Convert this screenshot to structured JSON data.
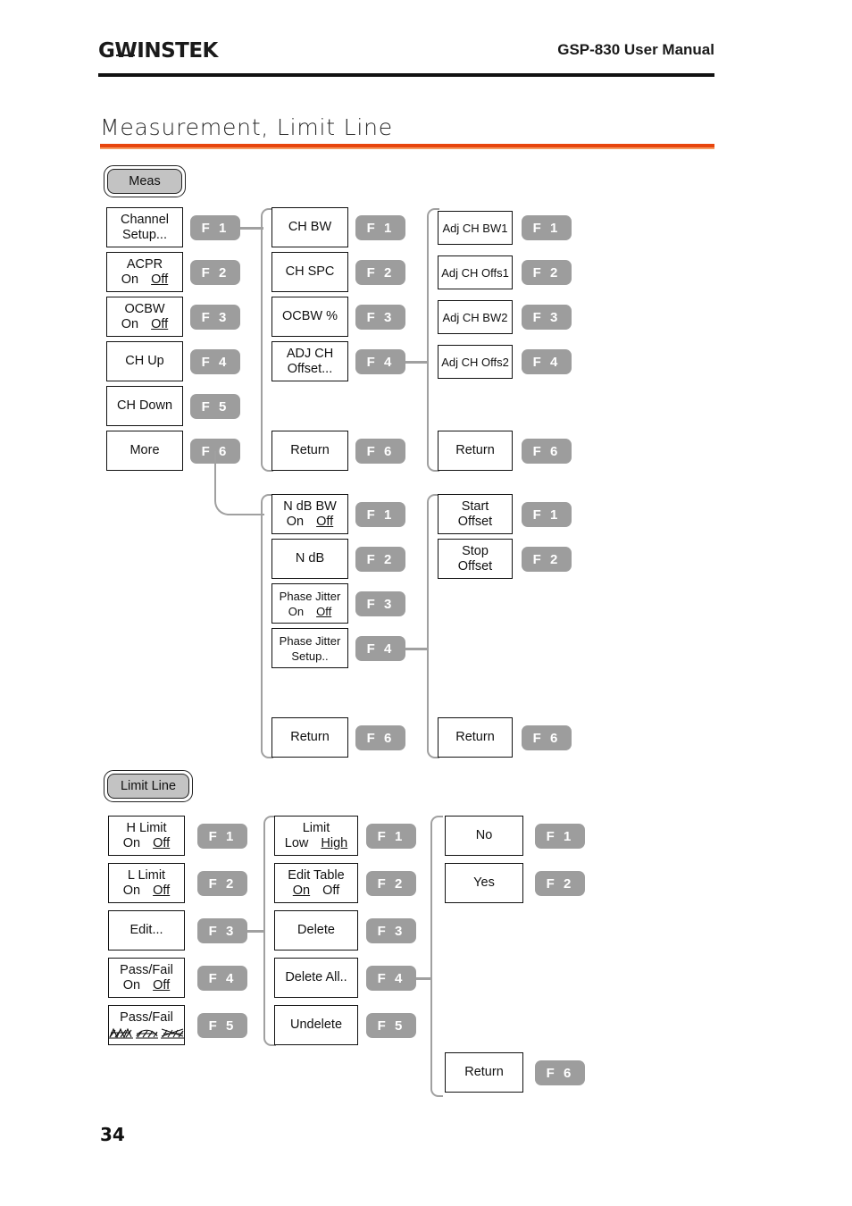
{
  "header": {
    "logo_g": "G",
    "logo_w": "W",
    "logo_rest": "INSTEK",
    "manual_title": "GSP-830 User Manual"
  },
  "page": {
    "title": "Measurement, Limit Line",
    "number": "34"
  },
  "meas_section": {
    "hardkey": "Meas",
    "col1": [
      {
        "fkey": "F 1",
        "l1": "Channel",
        "l2": "Setup..."
      },
      {
        "fkey": "F 2",
        "l1": "ACPR",
        "on": "On",
        "off": "Off",
        "selected": "off"
      },
      {
        "fkey": "F 3",
        "l1": "OCBW",
        "on": "On",
        "off": "Off",
        "selected": "off"
      },
      {
        "fkey": "F 4",
        "l1": "CH Up"
      },
      {
        "fkey": "F 5",
        "l1": "CH Down"
      },
      {
        "fkey": "F 6",
        "l1": "More"
      }
    ],
    "col2": [
      {
        "fkey": "F 1",
        "l1": "CH BW"
      },
      {
        "fkey": "F 2",
        "l1": "CH SPC"
      },
      {
        "fkey": "F 3",
        "l1": "OCBW %"
      },
      {
        "fkey": "F 4",
        "l1": "ADJ CH",
        "l2": "Offset..."
      },
      {
        "fkey": "F 6",
        "l1": "Return"
      }
    ],
    "col3": [
      {
        "fkey": "F 1",
        "l1": "Adj CH BW1"
      },
      {
        "fkey": "F 2",
        "l1": "Adj CH Offs1"
      },
      {
        "fkey": "F 3",
        "l1": "Adj CH BW2"
      },
      {
        "fkey": "F 4",
        "l1": "Adj CH Offs2"
      },
      {
        "fkey": "F 6",
        "l1": "Return"
      }
    ],
    "col2b": [
      {
        "fkey": "F 1",
        "l1": "N dB BW",
        "on": "On",
        "off": "Off",
        "selected": "off"
      },
      {
        "fkey": "F 2",
        "l1": "N dB"
      },
      {
        "fkey": "F 3",
        "l1": "Phase Jitter",
        "on": "On",
        "off": "Off",
        "selected": "off"
      },
      {
        "fkey": "F 4",
        "l1": "Phase Jitter",
        "l2": "Setup.."
      },
      {
        "fkey": "F 6",
        "l1": "Return"
      }
    ],
    "col3b": [
      {
        "fkey": "F 1",
        "l1": "Start",
        "l2": "Offset"
      },
      {
        "fkey": "F 2",
        "l1": "Stop",
        "l2": "Offset"
      },
      {
        "fkey": "F 6",
        "l1": "Return"
      }
    ]
  },
  "limit_section": {
    "hardkey": "Limit Line",
    "col1": [
      {
        "fkey": "F 1",
        "l1": "H Limit",
        "on": "On",
        "off": "Off",
        "selected": "off"
      },
      {
        "fkey": "F 2",
        "l1": "L Limit",
        "on": "On",
        "off": "Off",
        "selected": "off"
      },
      {
        "fkey": "F 3",
        "l1": "Edit..."
      },
      {
        "fkey": "F 4",
        "l1": "Pass/Fail",
        "on": "On",
        "off": "Off",
        "selected": "off"
      },
      {
        "fkey": "F 5",
        "l1": "Pass/Fail",
        "l2_obscured": true
      }
    ],
    "col2": [
      {
        "fkey": "F 1",
        "l1": "Limit",
        "on": "Low",
        "off": "High",
        "selected": "off"
      },
      {
        "fkey": "F 2",
        "l1": "Edit Table",
        "on": "On",
        "off": "Off",
        "selected": "on"
      },
      {
        "fkey": "F 3",
        "l1": "Delete"
      },
      {
        "fkey": "F 4",
        "l1": "Delete All.."
      },
      {
        "fkey": "F 5",
        "l1": "Undelete"
      }
    ],
    "col3": [
      {
        "fkey": "F 1",
        "l1": "No"
      },
      {
        "fkey": "F 2",
        "l1": "Yes"
      },
      {
        "fkey": "F 6",
        "l1": "Return"
      }
    ]
  },
  "colors": {
    "accent_orange": "#e8450d",
    "fkey_gray": "#9d9d9d",
    "hardkey_gray": "#c3c3c3",
    "connector_gray": "#a0a0a0"
  }
}
